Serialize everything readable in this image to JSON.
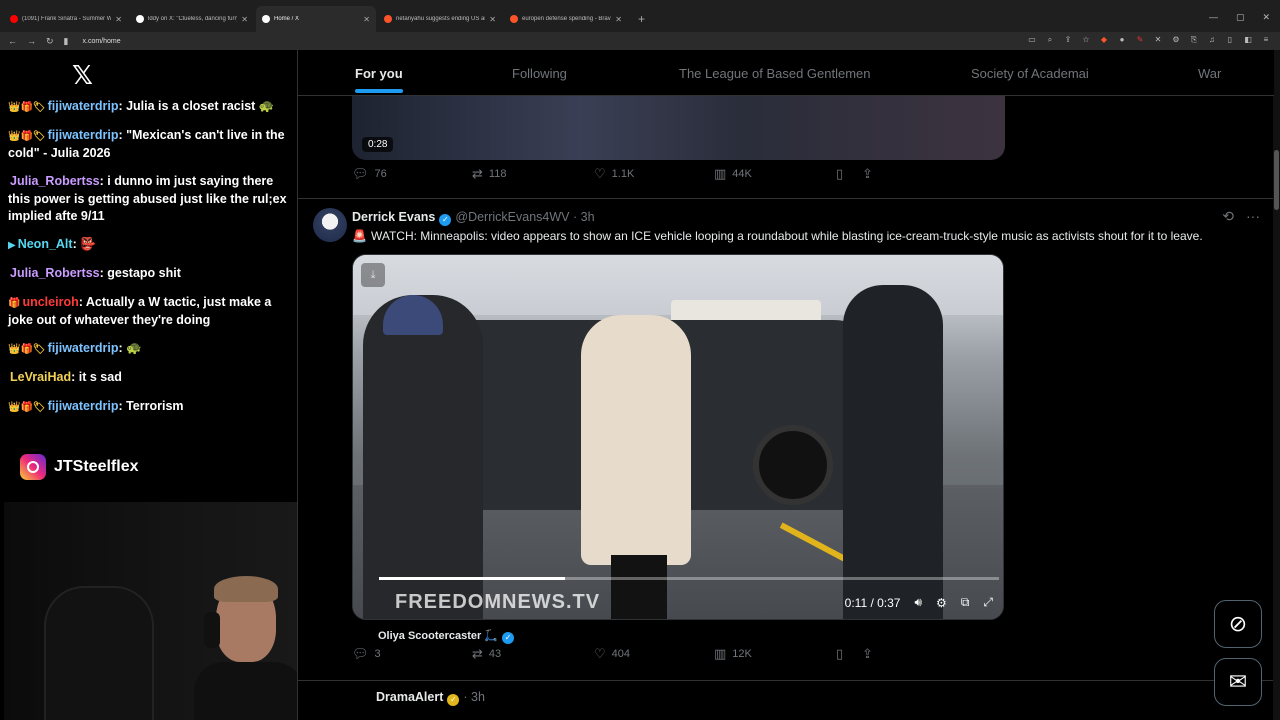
{
  "browser": {
    "tabs": [
      {
        "title": "(1091) Frank Sinatra - Summer Wind",
        "favcolor": "#ff0000"
      },
      {
        "title": "lddy on X: \"Clueless, dancing furry at",
        "favcolor": "#ffffff"
      },
      {
        "title": "Home / X",
        "favcolor": "#ffffff",
        "active": true
      },
      {
        "title": "netanyahu suggests ending US aid to",
        "favcolor": "#fb542b"
      },
      {
        "title": "europen defense spending - Brave S",
        "favcolor": "#fb542b"
      }
    ],
    "url": "x.com/home",
    "new_tab": "+"
  },
  "overlay": {
    "x_logo": "𝕏",
    "chat": [
      {
        "badges": "👑🎁🏷",
        "user": "fijiwaterdrip",
        "user_color": "blue",
        "text": ": Julia is a closet racist 🐢"
      },
      {
        "badges": "👑🎁🏷",
        "user": "fijiwaterdrip",
        "user_color": "blue",
        "text": ": \"Mexican's can't live in the cold\" - Julia 2026"
      },
      {
        "badges": "",
        "user": "Julia_Robertss",
        "user_color": "purple",
        "text": ": i dunno im just saying there this power is getting abused just like the rul;ex implied afte 9/11"
      },
      {
        "badges": "▶",
        "user": "Neon_Alt",
        "user_color": "cyan",
        "text": ": 👺"
      },
      {
        "badges": "",
        "user": "Julia_Robertss",
        "user_color": "purple",
        "text": ": gestapo shit"
      },
      {
        "badges": "🎁",
        "user": "uncleiroh",
        "user_color": "red",
        "text": ": Actually a W tactic, just make a joke out of whatever they're doing"
      },
      {
        "badges": "👑🎁🏷",
        "user": "fijiwaterdrip",
        "user_color": "blue",
        "text": ": 🐢"
      },
      {
        "badges": "",
        "user": "LeVraiHad",
        "user_color": "yellow",
        "text": ": it s sad"
      },
      {
        "badges": "👑🎁🏷",
        "user": "fijiwaterdrip",
        "user_color": "blue",
        "text": ": Terrorism"
      }
    ],
    "instagram_handle": "JTSteelflex"
  },
  "nav": {
    "tabs": [
      "For you",
      "Following",
      "The League of Based Gentlemen",
      "Society of Academai",
      "War"
    ]
  },
  "prev_tweet": {
    "duration": "0:28",
    "replies": "76",
    "retweets": "118",
    "likes": "1.1K",
    "views": "44K"
  },
  "tweet": {
    "name": "Derrick Evans",
    "handle": "@DerrickEvans4WV",
    "time": "· 3h",
    "text": "WATCH: Minneapolis: video appears to show an ICE vehicle looping a roundabout while blasting ice-cream-truck-style music as activists shout for it to leave.",
    "siren": "🚨",
    "video": {
      "watermark": "FREEDOMNEWS.TV",
      "time": "0:11 / 0:37",
      "progress": 0.3
    },
    "quoted_user": "Oliya Scootercaster 🛴",
    "replies": "3",
    "retweets": "43",
    "likes": "404",
    "views": "12K"
  },
  "next_tweet": {
    "name": "DramaAlert",
    "time": "· 3h"
  },
  "colors": {
    "accent": "#1d9bf0",
    "bg": "#000000",
    "muted": "#71767b"
  }
}
